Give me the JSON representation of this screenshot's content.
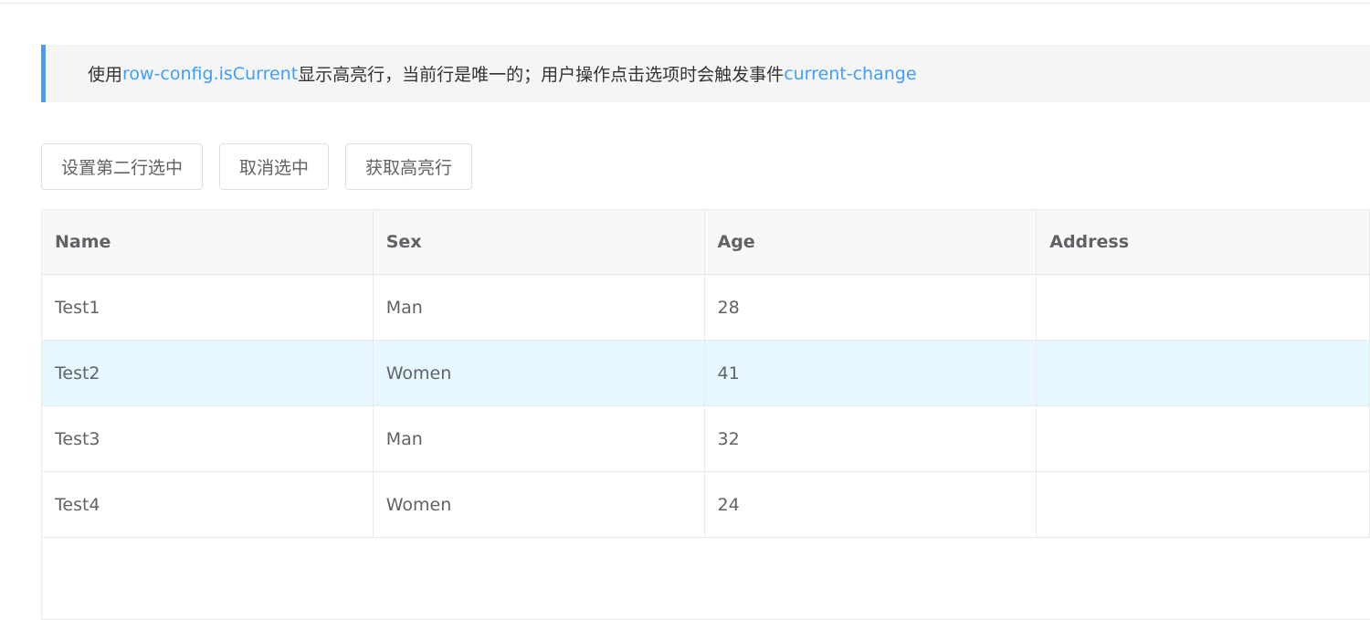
{
  "description": {
    "prefix": "使用 ",
    "code1": "row-config",
    "dot": ".",
    "code2": "isCurrent",
    "middle": " 显示高亮行，当前行是唯一的；用户操作点击选项时会触发事件 ",
    "code3": "current-change"
  },
  "toolbar": {
    "set_second_row": "设置第二行选中",
    "cancel_selection": "取消选中",
    "get_highlight": "获取高亮行"
  },
  "table": {
    "columns": [
      "Name",
      "Sex",
      "Age",
      "Address"
    ],
    "rows": [
      {
        "name": "Test1",
        "sex": "Man",
        "age": "28",
        "address": ""
      },
      {
        "name": "Test2",
        "sex": "Women",
        "age": "41",
        "address": ""
      },
      {
        "name": "Test3",
        "sex": "Man",
        "age": "32",
        "address": ""
      },
      {
        "name": "Test4",
        "sex": "Women",
        "age": "24",
        "address": ""
      }
    ],
    "current_row_index": 1
  },
  "colors": {
    "accent": "#409eff",
    "current_row_bg": "#e6f7ff",
    "header_bg": "#f8f8f9"
  }
}
